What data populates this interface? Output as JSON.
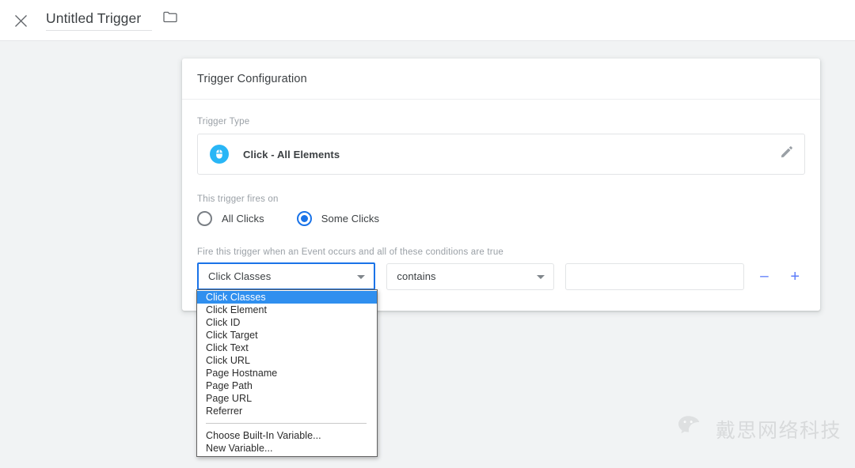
{
  "topbar": {
    "close_icon": "close-icon",
    "title_value": "Untitled Trigger",
    "title_placeholder": "Untitled Trigger",
    "folder_icon": "folder-icon"
  },
  "card": {
    "header_title": "Trigger Configuration",
    "trigger_type": {
      "label": "Trigger Type",
      "icon": "mouse-click-icon",
      "value": "Click - All Elements",
      "edit_icon": "pencil-icon"
    },
    "fires_on": {
      "label": "This trigger fires on",
      "options": [
        {
          "label": "All Clicks",
          "selected": false
        },
        {
          "label": "Some Clicks",
          "selected": true
        }
      ]
    },
    "conditions": {
      "label": "Fire this trigger when an Event occurs and all of these conditions are true",
      "variable_value": "Click Classes",
      "operator_value": "contains",
      "value_text": "",
      "value_placeholder": "",
      "remove_label": "–",
      "add_label": "+"
    }
  },
  "dropdown": {
    "items": [
      {
        "label": "Click Classes",
        "selected": true
      },
      {
        "label": "Click Element",
        "selected": false
      },
      {
        "label": "Click ID",
        "selected": false
      },
      {
        "label": "Click Target",
        "selected": false
      },
      {
        "label": "Click Text",
        "selected": false
      },
      {
        "label": "Click URL",
        "selected": false
      },
      {
        "label": "Page Hostname",
        "selected": false
      },
      {
        "label": "Page Path",
        "selected": false
      },
      {
        "label": "Page URL",
        "selected": false
      },
      {
        "label": "Referrer",
        "selected": false
      }
    ],
    "footer_items": [
      {
        "label": "Choose Built-In Variable..."
      },
      {
        "label": "New Variable..."
      }
    ]
  },
  "watermark": {
    "icon": "wechat-icon",
    "text": "戴思网络科技"
  },
  "colors": {
    "accent_blue": "#1a73e8",
    "highlight_blue": "#2f8fef",
    "trigger_icon_blue": "#29b6f6",
    "page_bg": "#f1f3f4",
    "card_bg": "#ffffff",
    "muted_text": "#9aa0a6",
    "body_text": "#3c4043",
    "plus_minus": "#5c7cfa"
  }
}
